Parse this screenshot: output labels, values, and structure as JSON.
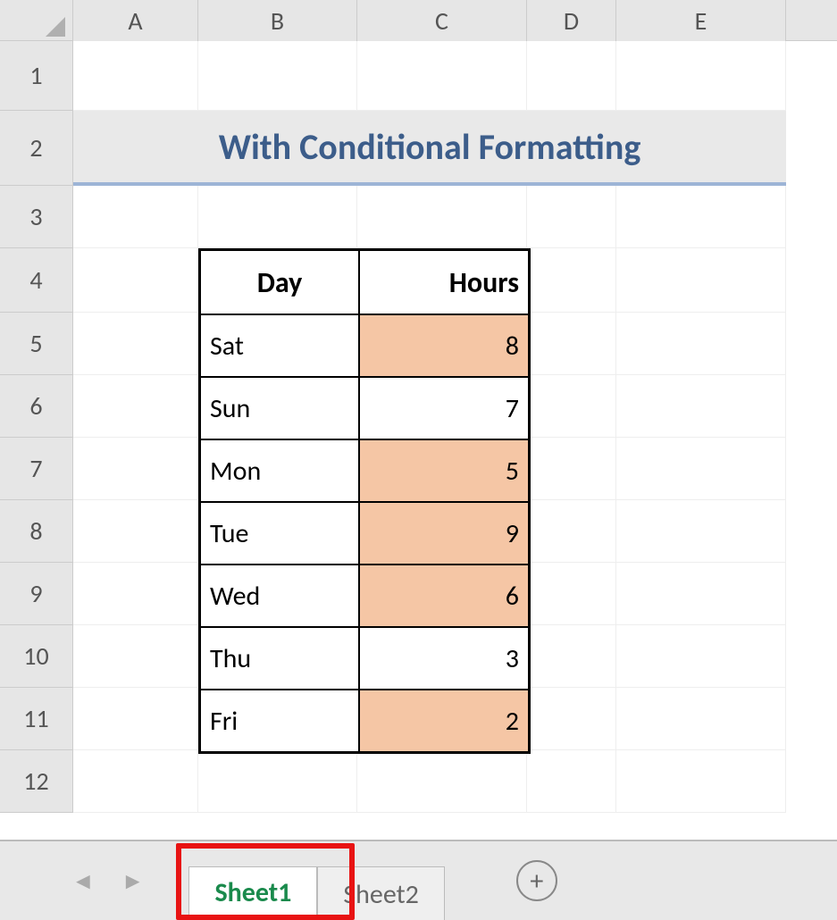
{
  "columns": [
    "A",
    "B",
    "C",
    "D",
    "E"
  ],
  "rows": [
    "1",
    "2",
    "3",
    "4",
    "5",
    "6",
    "7",
    "8",
    "9",
    "10",
    "11",
    "12"
  ],
  "title": "With Conditional Formatting",
  "table": {
    "header": {
      "day": "Day",
      "hours": "Hours"
    },
    "rows": [
      {
        "day": "Sat",
        "hours": 8,
        "highlight": true
      },
      {
        "day": "Sun",
        "hours": 7,
        "highlight": false
      },
      {
        "day": "Mon",
        "hours": 5,
        "highlight": true
      },
      {
        "day": "Tue",
        "hours": 9,
        "highlight": true
      },
      {
        "day": "Wed",
        "hours": 6,
        "highlight": true
      },
      {
        "day": "Thu",
        "hours": 3,
        "highlight": false
      },
      {
        "day": "Fri",
        "hours": 2,
        "highlight": true
      }
    ]
  },
  "sheets": {
    "active": "Sheet1",
    "tabs": [
      "Sheet1",
      "Sheet2"
    ]
  },
  "icons": {
    "nav_prev": "◄",
    "nav_next": "►",
    "add": "+"
  }
}
